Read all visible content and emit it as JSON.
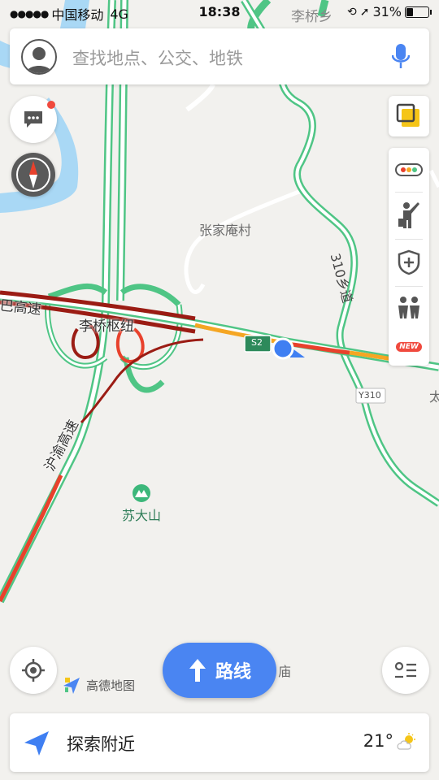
{
  "status_bar": {
    "carrier": "中国移动",
    "network": "4G",
    "time": "18:38",
    "battery": "31%",
    "battery_level": 0.31
  },
  "search": {
    "placeholder": "查找地点、公交、地铁"
  },
  "map": {
    "labels": {
      "top_place": "李桥乡",
      "village": "张家庵村",
      "interchange": "李桥枢纽",
      "highway_west": "巴高速",
      "highway_south": "沪渝高速",
      "road_county": "310乡道",
      "road_y310": "Y310",
      "road_s2": "S2",
      "mountain": "苏大山",
      "temple_char": "庙",
      "edge_char": "太"
    },
    "colors": {
      "road_green": "#4fc585",
      "road_dark_red": "#9b1c14",
      "road_red": "#e8412c",
      "road_orange": "#f5a623",
      "water": "#a9d8f5",
      "location_blue": "#3f7ff2"
    }
  },
  "controls": {
    "messages_icon": "message-icon",
    "compass_icon": "compass-icon",
    "layers_icon": "layers-icon",
    "traffic_icon": "traffic-light-icon",
    "hail_icon": "hail-icon",
    "safety_icon": "shield-plus-icon",
    "people_icon": "people-icon",
    "new_badge": "NEW",
    "locate_icon": "locate-icon",
    "list_icon": "list-icon"
  },
  "route_button": {
    "label": "路线"
  },
  "logo": {
    "text": "高德地图"
  },
  "bottom_bar": {
    "explore_label": "探索附近",
    "temperature": "21°",
    "weather_icon": "partly-cloudy-icon"
  }
}
